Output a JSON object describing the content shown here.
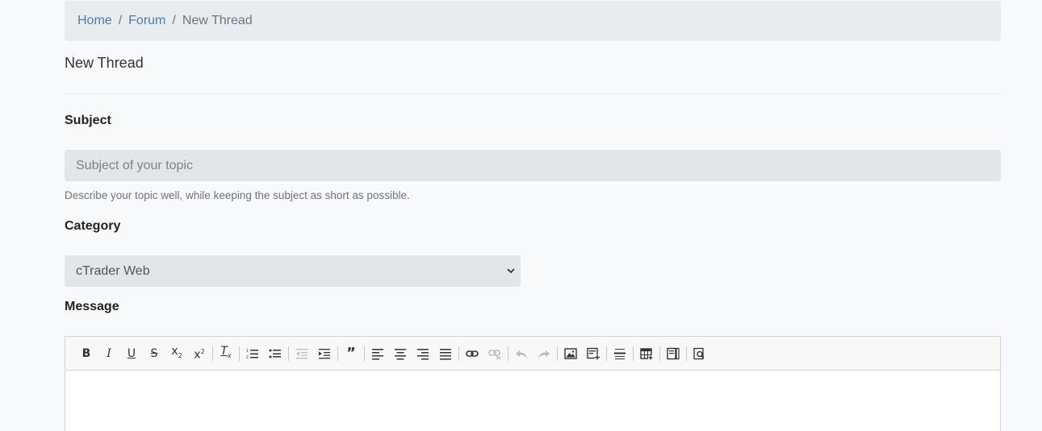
{
  "breadcrumb": {
    "home": "Home",
    "forum": "Forum",
    "separator": "/",
    "current": "New Thread"
  },
  "page_title": "New Thread",
  "subject": {
    "label": "Subject",
    "placeholder": "Subject of your topic",
    "value": "",
    "help": "Describe your topic well, while keeping the subject as short as possible."
  },
  "category": {
    "label": "Category",
    "selected": "cTrader Web"
  },
  "message": {
    "label": "Message",
    "toolbar": [
      "bold-icon",
      "italic-icon",
      "underline-icon",
      "strikethrough-icon",
      "subscript-icon",
      "superscript-icon",
      "remove-format-icon",
      "numbered-list-icon",
      "bulleted-list-icon",
      "outdent-icon",
      "indent-icon",
      "blockquote-icon",
      "align-left-icon",
      "align-center-icon",
      "align-right-icon",
      "align-justify-icon",
      "link-icon",
      "unlink-icon",
      "undo-icon",
      "redo-icon",
      "image-icon",
      "insert-media-icon",
      "horizontal-rule-icon",
      "table-icon",
      "source-icon",
      "preview-icon"
    ]
  },
  "colors": {
    "link": "#4a7bb7",
    "input_bg": "#e2e6e8",
    "page_bg": "#f7f9fa"
  }
}
